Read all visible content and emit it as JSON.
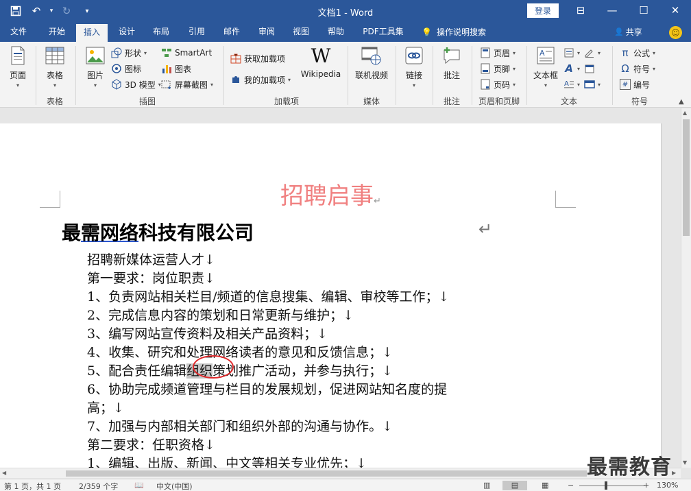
{
  "titlebar": {
    "title": "文档1 - Word",
    "login_label": "登录",
    "qat": {
      "save_icon": "💾",
      "undo_icon": "↶",
      "undo_caret": "▾",
      "redo_icon": "↻",
      "customize_icon": "▾"
    },
    "controls": {
      "ribbon_display": "⊟",
      "minimize": "—",
      "maximize": "☐",
      "close": "✕"
    }
  },
  "tabs": [
    "文件",
    "开始",
    "插入",
    "设计",
    "布局",
    "引用",
    "邮件",
    "审阅",
    "视图",
    "帮助",
    "PDF工具集"
  ],
  "active_tab": "插入",
  "tell_me": {
    "icon": "💡",
    "label": "操作说明搜索"
  },
  "share": {
    "icon": "👤",
    "label": "共享"
  },
  "feedback_icon": "☺",
  "ribbon": {
    "pages": {
      "label": "页面",
      "group": "",
      "caret": "▾"
    },
    "tables": {
      "label": "表格",
      "group": "表格",
      "caret": "▾"
    },
    "illustrations": {
      "group": "插图",
      "pictures": "图片",
      "shapes": "形状",
      "icons": "图标",
      "models3d": "3D 模型",
      "smartart": "SmartArt",
      "chart": "图表",
      "screenshot": "屏幕截图"
    },
    "addins": {
      "group": "加载项",
      "get": "获取加载项",
      "my": "我的加载项",
      "wikipedia": "Wikipedia",
      "wiki_glyph": "W"
    },
    "media": {
      "group": "媒体",
      "online_video": "联机视频"
    },
    "links": {
      "label": "链接",
      "group": ""
    },
    "comments": {
      "group": "批注",
      "comment": "批注"
    },
    "header_footer": {
      "group": "页眉和页脚",
      "header": "页眉",
      "footer": "页脚",
      "page_number": "页码"
    },
    "text": {
      "group": "文本",
      "textbox": "文本框"
    },
    "symbols": {
      "group": "符号",
      "equation": "公式",
      "symbol": "符号",
      "number": "编号",
      "pi": "π",
      "omega": "Ω",
      "hash": "#"
    }
  },
  "document": {
    "title": "招聘启事",
    "company_prefix": "最",
    "company_underlined": "需网络",
    "company_suffix": "科技有限公司",
    "para_mark": "↵",
    "lines": [
      "招聘新媒体运营人才↓",
      "第一要求：岗位职责↓",
      "1、负责网站相关栏目/频道的信息搜集、编辑、审校等工作；↓",
      "2、完成信息内容的策划和日常更新与维护；↓",
      "3、编写网站宣传资料及相关产品资料；↓",
      "4、收集、研究和处理网络读者的意见和反馈信息；↓",
      "6、协助完成频道管理与栏目的发展规划，促进网站知名度的提",
      "高；↓",
      "7、加强与内部相关部门和组织外部的沟通与协作。↓",
      "第二要求：任职资格↓",
      "1、编辑、出版、新闻、中文等相关专业优先；↓"
    ],
    "line5_before": "5、配合责任编辑",
    "line5_highlight": "组织",
    "line5_after": "策划推广活动，并参与执行；↓"
  },
  "watermark": "最需教育",
  "statusbar": {
    "page_info": "第 1 页，共 1 页",
    "word_count": "2/359 个字",
    "lang": "中文(中国)",
    "zoom_minus": "−",
    "zoom_plus": "+",
    "zoom_level": "130%"
  },
  "colors": {
    "accent": "#2b579a",
    "title_red": "#f08080",
    "annotation_red": "#e0292b"
  }
}
